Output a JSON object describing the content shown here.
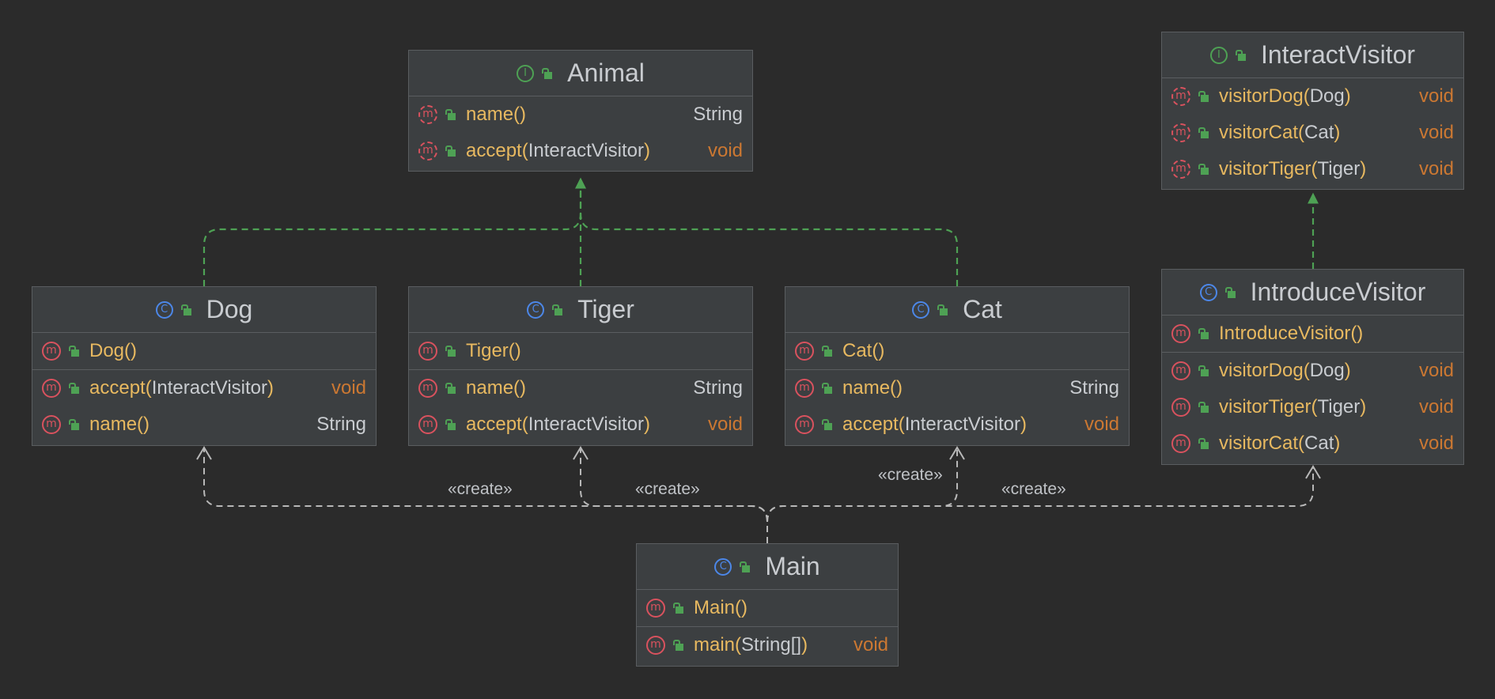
{
  "nodes": {
    "animal": {
      "kind": "I",
      "name": "Animal",
      "sections": [
        [
          {
            "name": "name",
            "params": "",
            "ret": "String",
            "abstract": true
          },
          {
            "name": "accept",
            "params": "InteractVisitor",
            "ret": "void",
            "abstract": true
          }
        ]
      ]
    },
    "interactvisitor": {
      "kind": "I",
      "name": "InteractVisitor",
      "sections": [
        [
          {
            "name": "visitorDog",
            "params": "Dog",
            "ret": "void",
            "abstract": true
          },
          {
            "name": "visitorCat",
            "params": "Cat",
            "ret": "void",
            "abstract": true
          },
          {
            "name": "visitorTiger",
            "params": "Tiger",
            "ret": "void",
            "abstract": true
          }
        ]
      ]
    },
    "dog": {
      "kind": "C",
      "name": "Dog",
      "sections": [
        [
          {
            "name": "Dog",
            "params": "",
            "ret": ""
          }
        ],
        [
          {
            "name": "accept",
            "params": "InteractVisitor",
            "ret": "void"
          },
          {
            "name": "name",
            "params": "",
            "ret": "String"
          }
        ]
      ]
    },
    "tiger": {
      "kind": "C",
      "name": "Tiger",
      "sections": [
        [
          {
            "name": "Tiger",
            "params": "",
            "ret": ""
          }
        ],
        [
          {
            "name": "name",
            "params": "",
            "ret": "String"
          },
          {
            "name": "accept",
            "params": "InteractVisitor",
            "ret": "void"
          }
        ]
      ]
    },
    "cat": {
      "kind": "C",
      "name": "Cat",
      "sections": [
        [
          {
            "name": "Cat",
            "params": "",
            "ret": ""
          }
        ],
        [
          {
            "name": "name",
            "params": "",
            "ret": "String"
          },
          {
            "name": "accept",
            "params": "InteractVisitor",
            "ret": "void"
          }
        ]
      ]
    },
    "introducevisitor": {
      "kind": "C",
      "name": "IntroduceVisitor",
      "sections": [
        [
          {
            "name": "IntroduceVisitor",
            "params": "",
            "ret": ""
          }
        ],
        [
          {
            "name": "visitorDog",
            "params": "Dog",
            "ret": "void"
          },
          {
            "name": "visitorTiger",
            "params": "Tiger",
            "ret": "void"
          },
          {
            "name": "visitorCat",
            "params": "Cat",
            "ret": "void"
          }
        ]
      ]
    },
    "main": {
      "kind": "C",
      "name": "Main",
      "sections": [
        [
          {
            "name": "Main",
            "params": "",
            "ret": ""
          }
        ],
        [
          {
            "name": "main",
            "params": "String[]",
            "ret": "void"
          }
        ]
      ]
    }
  },
  "edges": {
    "implements": [
      {
        "from": "dog",
        "to": "animal"
      },
      {
        "from": "tiger",
        "to": "animal"
      },
      {
        "from": "cat",
        "to": "animal"
      },
      {
        "from": "introducevisitor",
        "to": "interactvisitor"
      }
    ],
    "create": [
      {
        "from": "main",
        "to": "dog",
        "label": "«create»"
      },
      {
        "from": "main",
        "to": "tiger",
        "label": "«create»"
      },
      {
        "from": "main",
        "to": "cat",
        "label": "«create»"
      },
      {
        "from": "main",
        "to": "introducevisitor",
        "label": "«create»"
      }
    ]
  },
  "colors": {
    "background": "#2b2b2b",
    "box": "#3c3f41",
    "border": "#5a5d60",
    "implements": "#4ea154",
    "create": "#b8b8b8",
    "method": "#e8b960",
    "type": "#c9ccd0",
    "void": "#cc7832",
    "classIcon": "#4c87e8",
    "interfaceIcon": "#4ea154",
    "methodIcon": "#d9525e"
  }
}
